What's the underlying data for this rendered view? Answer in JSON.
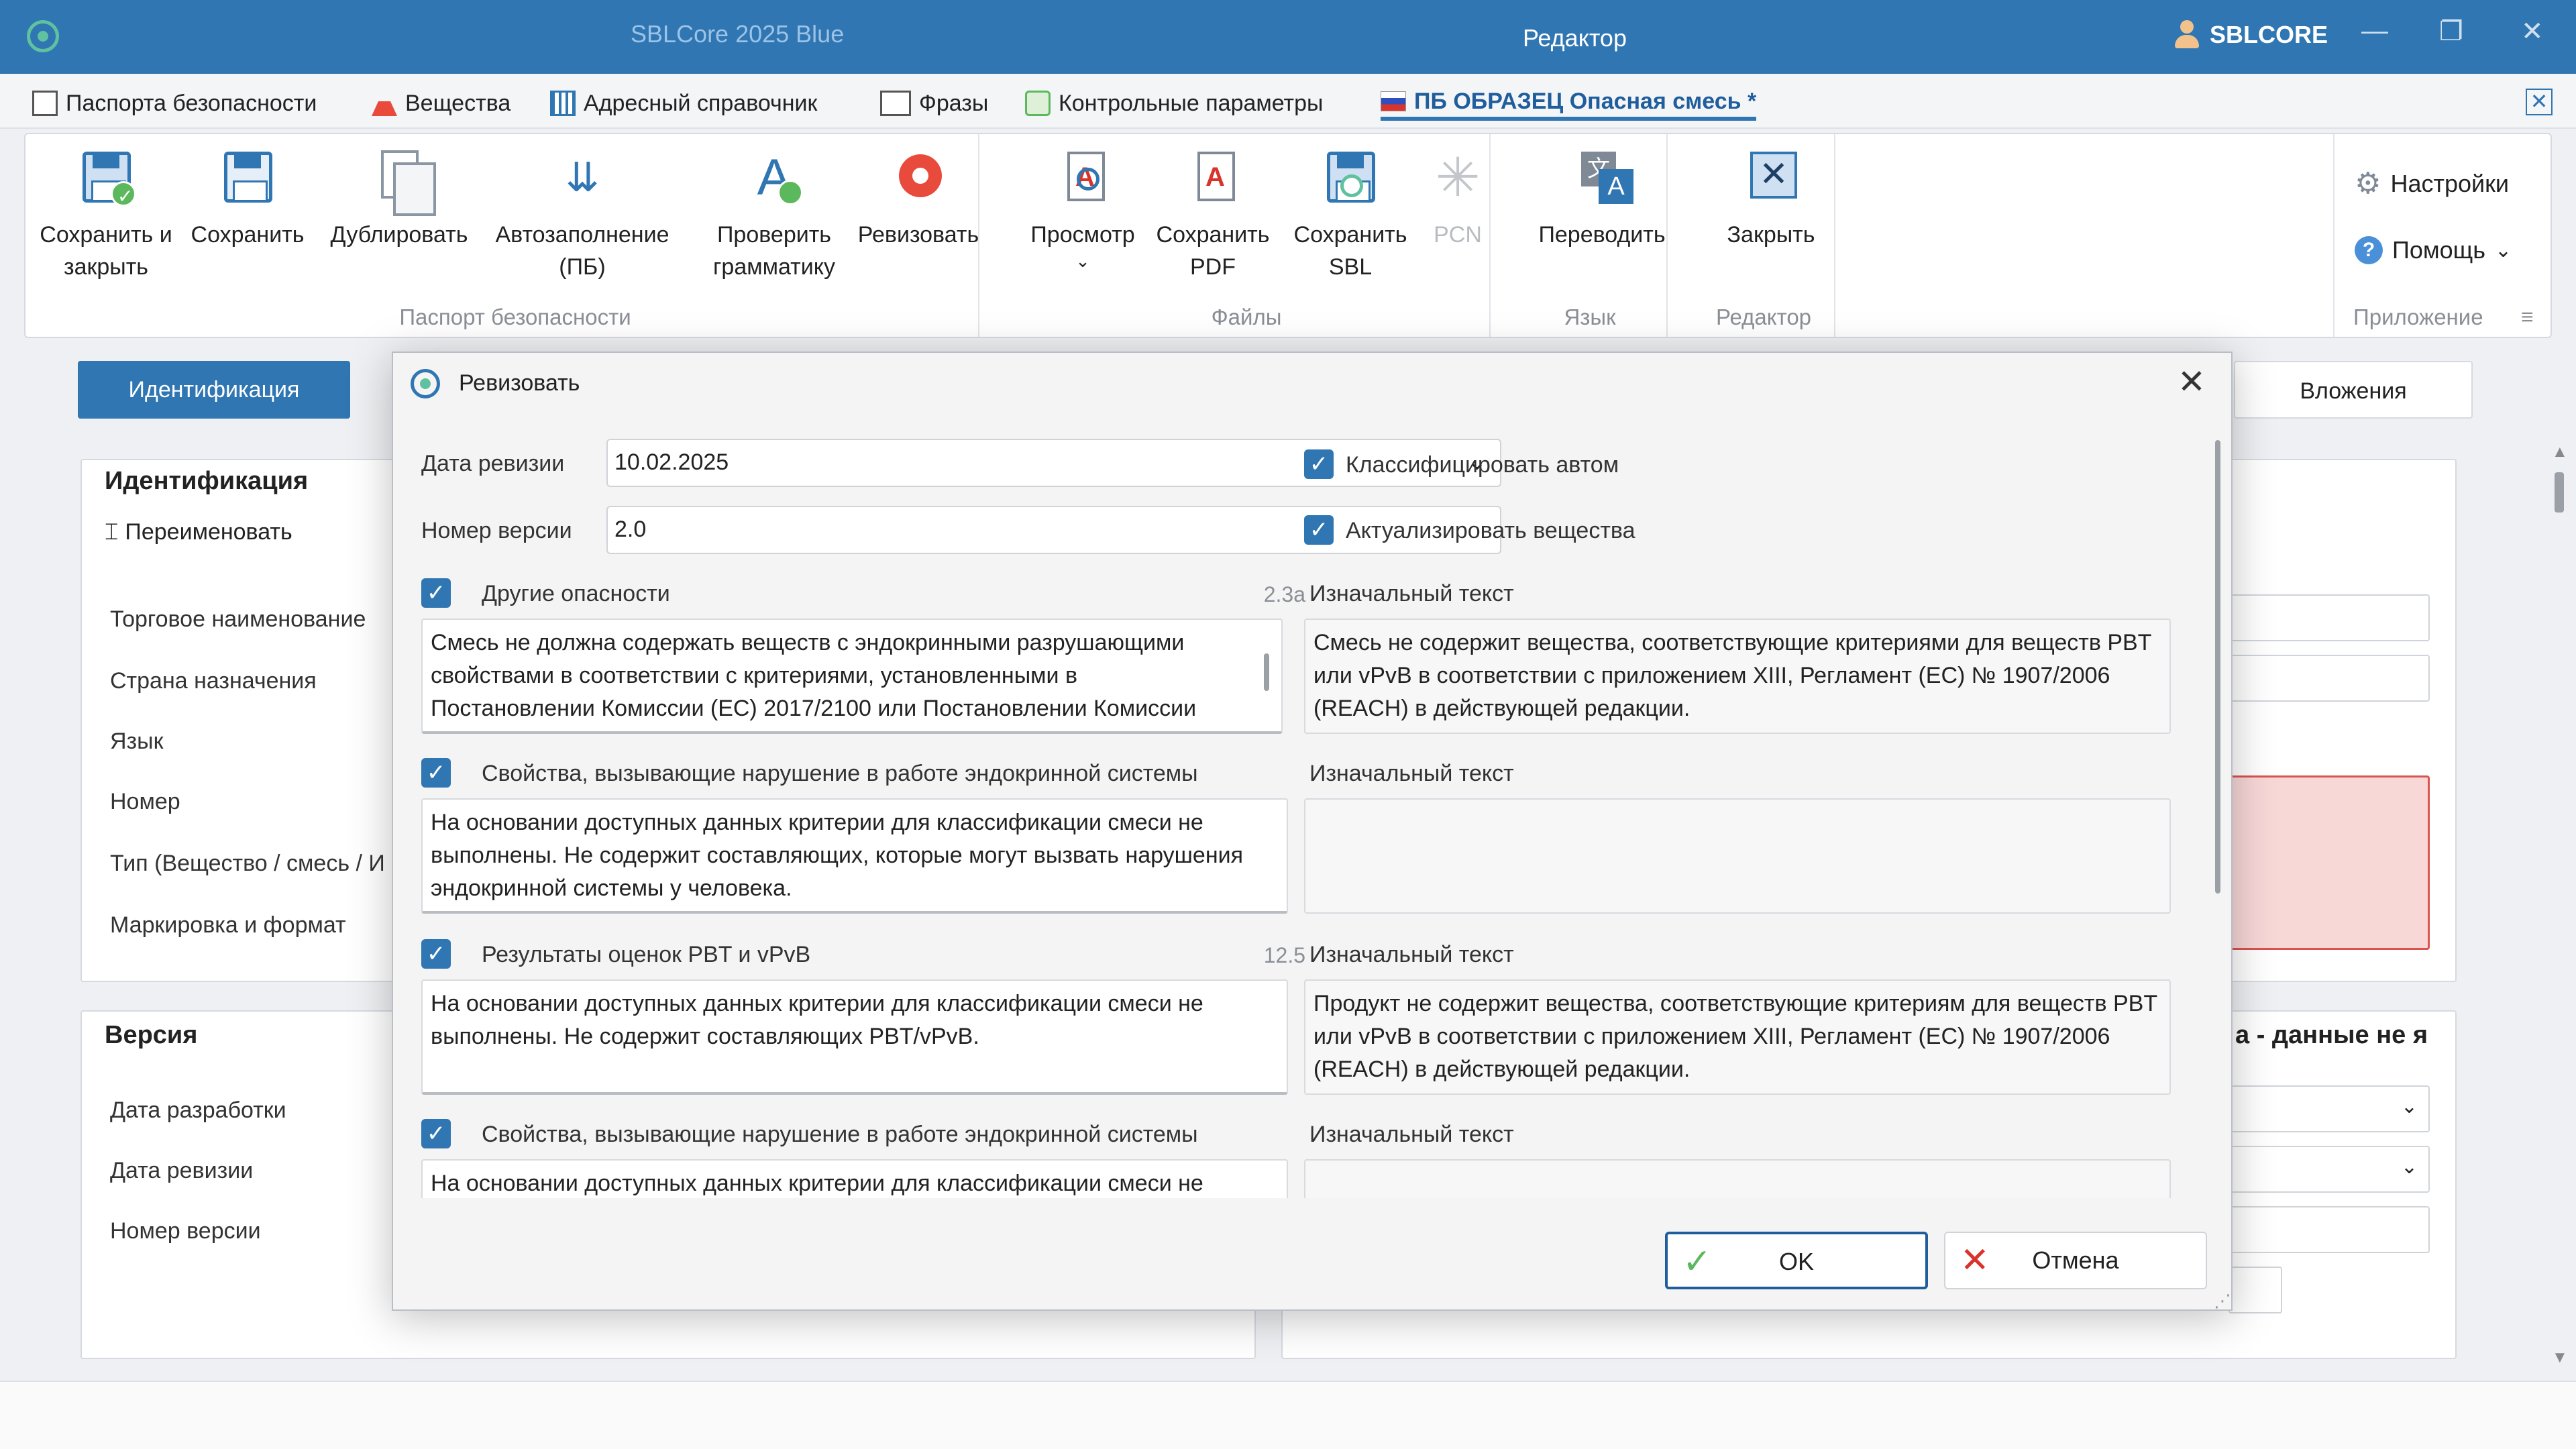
{
  "titlebar": {
    "app_name": "SBLCore 2025 Blue",
    "title": "Редактор",
    "user": "SBLCORE",
    "minimize": "—",
    "restore": "❐",
    "close": "✕"
  },
  "tabs": [
    {
      "label": "Паспорта безопасности"
    },
    {
      "label": "Вещества"
    },
    {
      "label": "Адресный справочник"
    },
    {
      "label": "Фразы"
    },
    {
      "label": "Контрольные параметры"
    },
    {
      "label": "ПБ ОБРАЗЕЦ Опасная смесь *"
    }
  ],
  "tabbar_close": "✕",
  "ribbon": {
    "groups": {
      "passport": "Паспорт безопасности",
      "files": "Файлы",
      "language": "Язык",
      "editor": "Редактор",
      "application": "Приложение"
    },
    "buttons": {
      "save_close": "Сохранить и закрыть",
      "save": "Сохранить",
      "duplicate": "Дублировать",
      "autofill": "Автозаполнение (ПБ)",
      "grammar": "Проверить грамматику",
      "revise": "Ревизовать",
      "preview": "Просмотр",
      "save_pdf": "Сохранить PDF",
      "save_sbl": "Сохранить SBL",
      "pcn": "PCN",
      "translate": "Переводить",
      "close": "Закрыть",
      "settings": "Настройки",
      "help": "Помощь"
    }
  },
  "background": {
    "nav_identification": "Идентификация",
    "nav_attachments": "Вложения",
    "panel_ident_title": "Идентификация",
    "rename": "Переименовать",
    "fields": [
      "Торговое наименование",
      "Страна назначения",
      "Язык",
      "Номер",
      "Тип (Вещество / смесь / И",
      "Маркировка и формат"
    ],
    "panel_version_title": "Версия",
    "version_fields": [
      "Дата разработки",
      "Дата ревизии",
      "Номер версии"
    ],
    "right_header_fragment": "а - данные не я"
  },
  "dialog": {
    "title": "Ревизовать",
    "revision_date_label": "Дата ревизии",
    "revision_date_value": "10.02.2025",
    "version_label": "Номер версии",
    "version_value": "2.0",
    "classify_auto": "Классифицировать автом",
    "update_substances": "Актуализировать вещества",
    "original_text_label": "Изначальный текст",
    "sections": [
      {
        "label": "Другие опасности",
        "code": "2.3a",
        "text": "Смесь не должна содержать веществ с эндокринными разрушающими свойствами в соответствии с критериями, установленными в Постановлении Комиссии (ЕС) 2017/2100 или Постановлении Комиссии",
        "original": "Смесь не содержит вещества, соответствующие критериями для веществ PBT или vPvB в соответствии с приложением XIII, Регламент (ЕС) № 1907/2006 (REACH) в действующей редакции."
      },
      {
        "label": "Свойства, вызывающие нарушение в работе эндокринной системы",
        "code": "",
        "text": "На основании доступных данных критерии для классификации смеси не выполнены. Не содержит составляющих, которые могут вызвать нарушения эндокринной системы у человека.",
        "original": ""
      },
      {
        "label": "Результаты оценок PBT и vPvB",
        "code": "12.5",
        "text": "На основании доступных данных критерии для классификации смеси не выполнены. Не содержит составляющих PBT/vPvB.",
        "original": "Продукт не содержит вещества, соответствующие критериям для веществ PBT или vPvB в соответствии с приложением XIII, Регламент (ЕС) № 1907/2006 (REACH) в действующей редакции."
      },
      {
        "label": "Свойства, вызывающие нарушение в работе эндокринной системы",
        "code": "",
        "text": "На основании доступных данных критерии для классификации смеси не",
        "original": ""
      }
    ],
    "ok": "OK",
    "cancel": "Отмена"
  }
}
